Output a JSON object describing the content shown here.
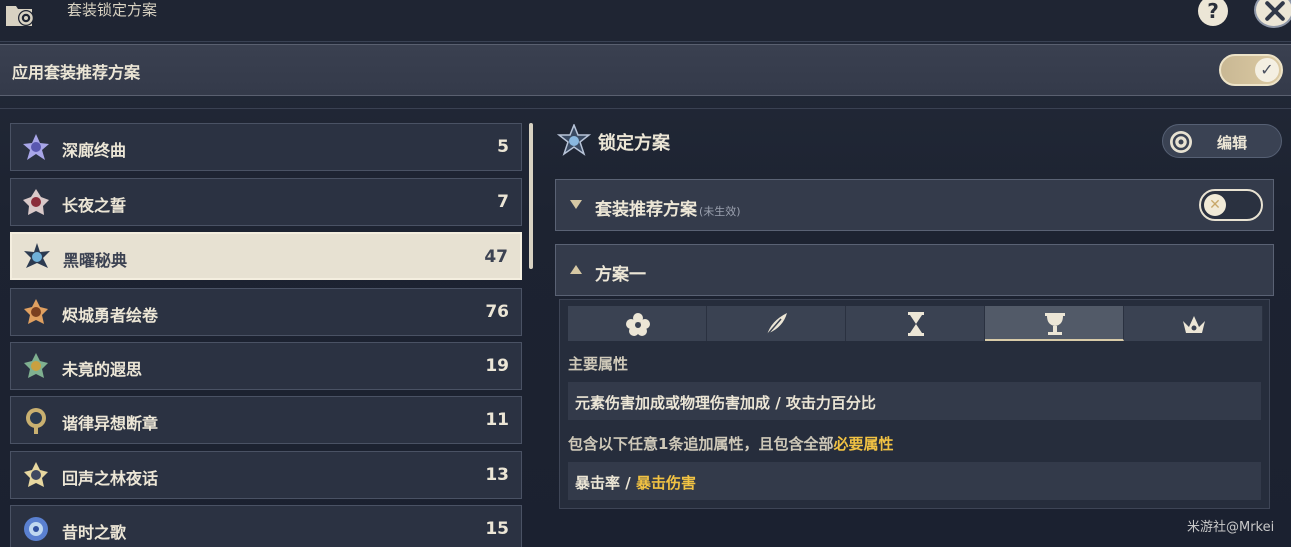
{
  "topbar": {
    "title": "套装锁定方案"
  },
  "apply": {
    "label": "应用套装推荐方案",
    "toggle_check": "✓"
  },
  "sets": [
    {
      "name": "深廊终曲",
      "count": "5"
    },
    {
      "name": "长夜之誓",
      "count": "7"
    },
    {
      "name": "黑曜秘典",
      "count": "47"
    },
    {
      "name": "烬城勇者绘卷",
      "count": "76"
    },
    {
      "name": "未竟的遐思",
      "count": "19"
    },
    {
      "name": "谐律异想断章",
      "count": "11"
    },
    {
      "name": "回声之林夜话",
      "count": "13"
    },
    {
      "name": "昔时之歌",
      "count": "15"
    }
  ],
  "right": {
    "lock_title": "锁定方案",
    "edit_label": "编辑",
    "recommend": {
      "title": "套装推荐方案",
      "sub": "(未生效)",
      "toggle_x": "✕"
    },
    "plan": {
      "title": "方案一"
    },
    "main_attr_label": "主要属性",
    "main_attr_value": "元素伤害加成或物理伤害加成 / 攻击力百分比",
    "sub_attr_prefix": "包含以下任意1条追加属性，且包含全部",
    "sub_attr_highlight": "必要属性",
    "sub_attr_value_normal": "暴击率 / ",
    "sub_attr_value_highlight": "暴击伤害"
  },
  "colors": {
    "accent_gold": "#f1c243",
    "selected_bg": "#e7e1d2"
  },
  "watermark": "米游社@Mrkei"
}
